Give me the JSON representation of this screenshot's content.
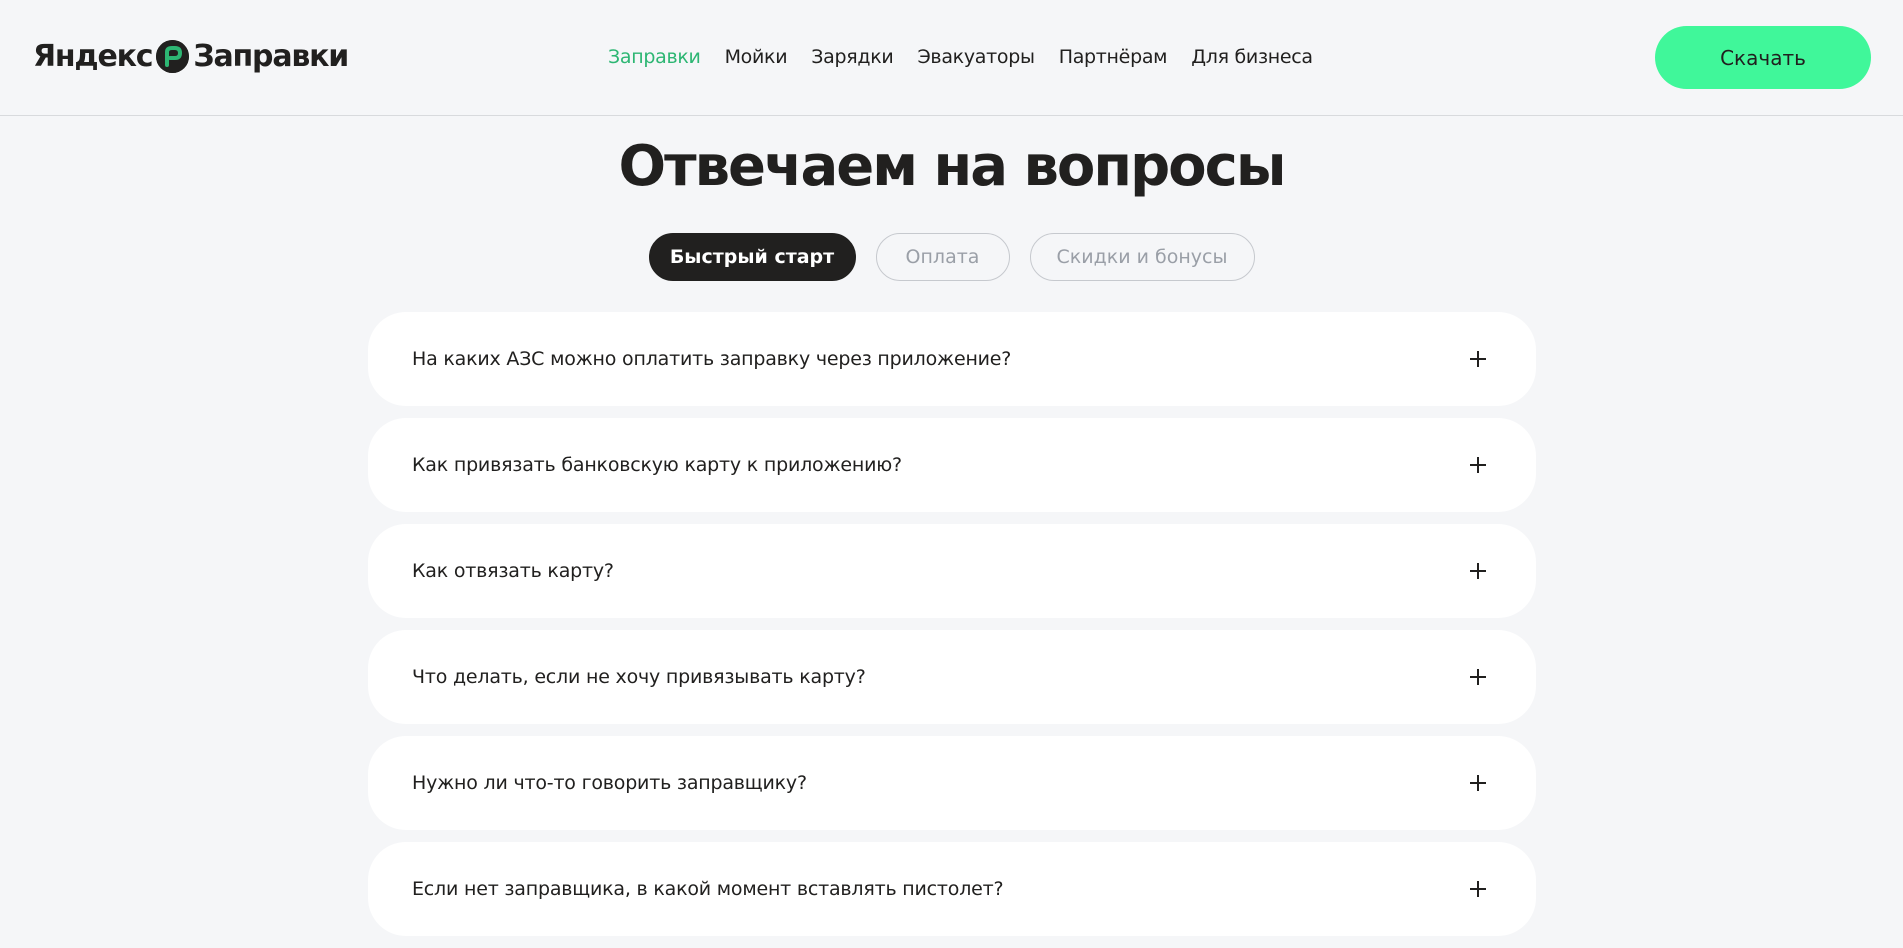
{
  "header": {
    "logo": {
      "left_word": "Яндекс",
      "right_word": "Заправки",
      "mark_color": "#21201f",
      "mark_accent": "#2db673"
    },
    "nav": [
      {
        "label": "Заправки",
        "active": true
      },
      {
        "label": "Мойки",
        "active": false
      },
      {
        "label": "Зарядки",
        "active": false
      },
      {
        "label": "Эвакуаторы",
        "active": false
      },
      {
        "label": "Партнёрам",
        "active": false
      },
      {
        "label": "Для бизнеса",
        "active": false
      }
    ],
    "download_label": "Скачать"
  },
  "main": {
    "title": "Отвечаем на вопросы",
    "tabs": [
      {
        "label": "Быстрый старт",
        "active": true
      },
      {
        "label": "Оплата",
        "active": false
      },
      {
        "label": "Скидки и бонусы",
        "active": false
      }
    ],
    "faq": [
      {
        "question": "На каких АЗС можно оплатить заправку через приложение?"
      },
      {
        "question": "Как привязать банковскую карту к приложению?"
      },
      {
        "question": "Как отвязать карту?"
      },
      {
        "question": "Что делать, если не хочу привязывать карту?"
      },
      {
        "question": "Нужно ли что-то говорить заправщику?"
      },
      {
        "question": "Если нет заправщика, в какой момент вставлять пистолет?"
      }
    ]
  },
  "colors": {
    "accent_green": "#2db673",
    "button_green": "#40f79a",
    "background": "#f5f6f8",
    "text": "#21201f",
    "muted": "#9a9fa7"
  },
  "icons": {
    "faq_expand": "plus-icon",
    "logo": "fuel-logo-icon"
  }
}
